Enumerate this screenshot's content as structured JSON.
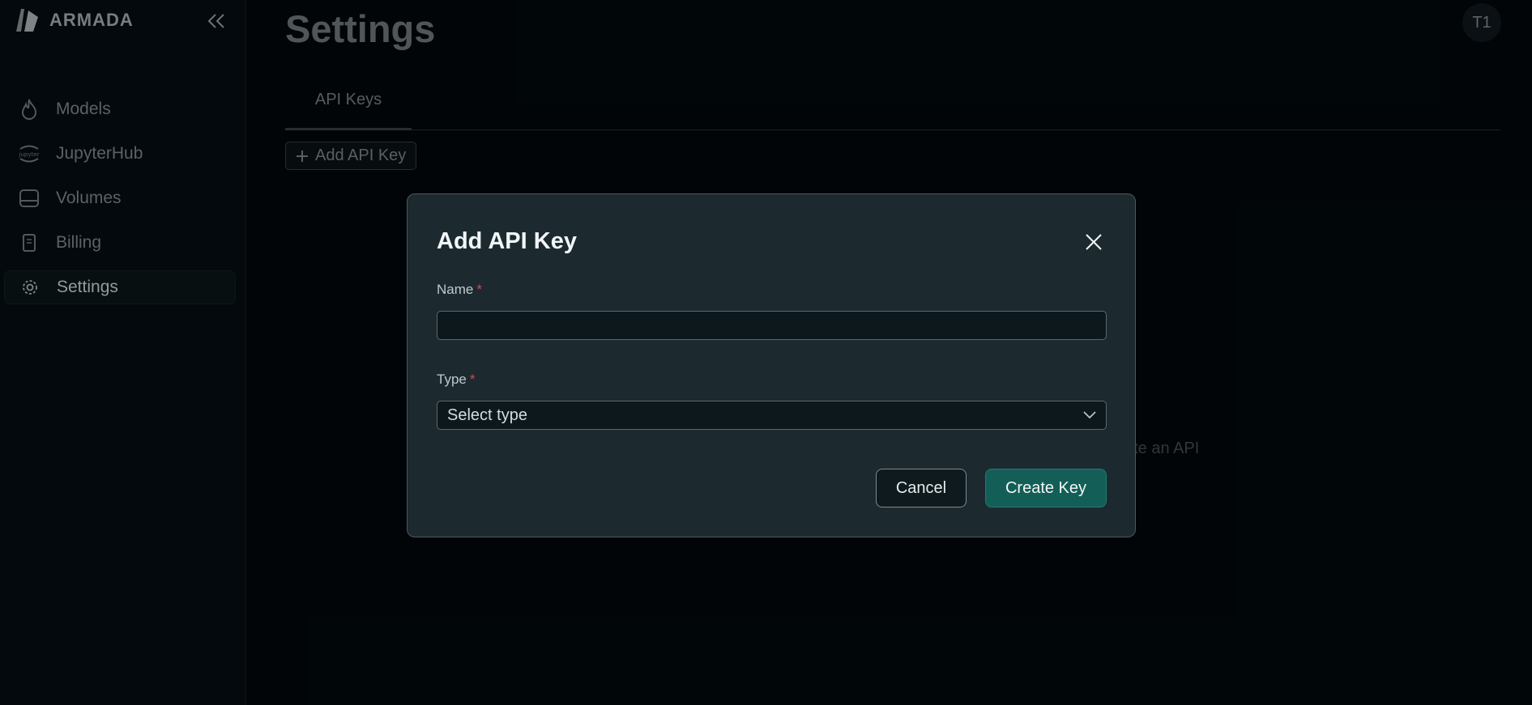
{
  "app": {
    "logo_text": "ARMADA",
    "user_initials": "T1"
  },
  "sidebar": {
    "items": [
      {
        "label": "Models",
        "icon": "flame-icon"
      },
      {
        "label": "JupyterHub",
        "icon": "jupyter-icon"
      },
      {
        "label": "Volumes",
        "icon": "drive-icon"
      },
      {
        "label": "Billing",
        "icon": "receipt-icon"
      },
      {
        "label": "Settings",
        "icon": "gear-icon",
        "active": true
      }
    ]
  },
  "main": {
    "title": "Settings",
    "tabs": [
      {
        "label": "API Keys",
        "active": true
      }
    ],
    "add_button_label": "Add API Key",
    "empty_hint_fragment": "ate an API"
  },
  "modal": {
    "title": "Add API Key",
    "name_label": "Name",
    "name_value": "",
    "required_mark": "*",
    "type_label": "Type",
    "type_selected": "Select type",
    "cancel_label": "Cancel",
    "create_label": "Create Key"
  },
  "colors": {
    "background": "#02090c",
    "modal_bg": "#1c2a30",
    "accent": "#135f57",
    "required": "#d04a48"
  }
}
